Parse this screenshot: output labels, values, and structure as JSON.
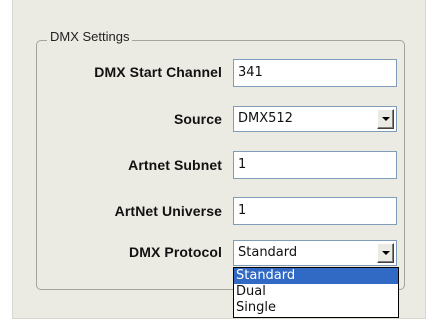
{
  "group": {
    "title": "DMX Settings"
  },
  "fields": {
    "start_channel": {
      "label": "DMX Start Channel",
      "value": "341"
    },
    "source": {
      "label": "Source",
      "value": "DMX512"
    },
    "artnet_subnet": {
      "label": "Artnet Subnet",
      "value": "1"
    },
    "artnet_universe": {
      "label": "ArtNet Universe",
      "value": "1"
    },
    "protocol": {
      "label": "DMX Protocol",
      "value": "Standard",
      "options": [
        "Standard",
        "Dual",
        "Single"
      ],
      "selected": "Standard"
    }
  },
  "colors": {
    "panel_bg": "#ecebe3",
    "field_border": "#7f9db9",
    "selection": "#316ac5"
  },
  "icons": {
    "dropdown": "chevron-down-icon"
  }
}
